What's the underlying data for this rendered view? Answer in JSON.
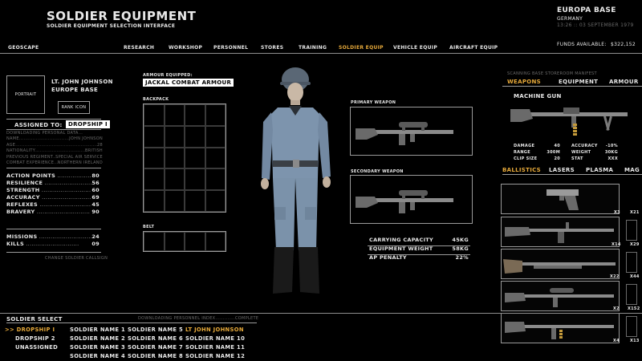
{
  "header": {
    "title": "SOLDIER EQUIPMENT",
    "subtitle": "SOLDIER EQUIPMENT SELECTION INTERFACE",
    "base_name": "EUROPA BASE",
    "base_country": "GERMANY",
    "base_time": "13:26 :: 03 SEPTEMBER 1979",
    "funds_label": "FUNDS AVAILABLE:",
    "funds_value": "$322,152"
  },
  "nav": {
    "items": [
      "GEOSCAPE",
      "RESEARCH",
      "WORKSHOP",
      "PERSONNEL",
      "STORES",
      "TRAINING",
      "SOLDIER EQUIP",
      "VEHICLE EQUIP",
      "AIRCRAFT EQUIP"
    ],
    "active": "SOLDIER EQUIP",
    "accent_color": "#e6a93a"
  },
  "soldier": {
    "portrait_label": "PORTRAIT",
    "rank_icon_label": "RANK ICON",
    "name": "LT. JOHN JOHNSON",
    "base": "EUROPE BASE",
    "assigned_label": "ASSIGNED TO:",
    "assigned_value": "DROPSHIP I",
    "personal_data": [
      {
        "key": "DOWNLOADING PERSONAL DATA...",
        "value": ""
      },
      {
        "key": "NAME",
        "value": "JOHN JOHNSON"
      },
      {
        "key": "AGE",
        "value": "28"
      },
      {
        "key": "NATIONALITY",
        "value": "BRITISH"
      },
      {
        "key": "PREVIOUS REGIMENT",
        "value": "SPECIAL AIR SERVICE"
      },
      {
        "key": "COMBAT EXPERIENCE",
        "value": "NORTHERN IRELAND"
      }
    ],
    "stats": [
      {
        "label": "ACTION POINTS",
        "value": "80"
      },
      {
        "label": "RESILIENCE",
        "value": "56"
      },
      {
        "label": "STRENGTH",
        "value": "60"
      },
      {
        "label": "ACCURACY",
        "value": "69"
      },
      {
        "label": "REFLEXES",
        "value": "45"
      },
      {
        "label": "BRAVERY",
        "value": "90"
      }
    ],
    "record": [
      {
        "label": "MISSIONS",
        "value": "24"
      },
      {
        "label": "KILLS",
        "value": "09"
      }
    ],
    "change_callsign": "CHANGE SOLDIER CALLSIGN"
  },
  "loadout": {
    "armour_label": "ARMOUR EQUIPPED:",
    "armour_value": "JACKAL COMBAT ARMOUR",
    "backpack_label": "BACKPACK",
    "belt_label": "BELT",
    "primary_label": "PRIMARY WEAPON",
    "secondary_label": "SECONDARY WEAPON",
    "capacity": [
      {
        "label": "CARRYING CAPACITY",
        "value": "45KG"
      },
      {
        "label": "EQUIPMENT WEIGHT",
        "value": "58KG"
      },
      {
        "label": "AP PENALTY",
        "value": "22%"
      }
    ]
  },
  "stores": {
    "manifest_label": "SCANNING BASE STOREROOM MANIFEST",
    "categories": [
      "WEAPONS",
      "EQUIPMENT",
      "ARMOUR"
    ],
    "active_category": "WEAPONS",
    "selected_weapon": "MACHINE GUN",
    "weapon_stats": [
      {
        "label": "DAMAGE",
        "value": "40"
      },
      {
        "label": "RANGE",
        "value": "300M"
      },
      {
        "label": "CLIP SIZE",
        "value": "20"
      },
      {
        "label": "ACCURACY",
        "value": "-10%"
      },
      {
        "label": "WEIGHT",
        "value": "30KG"
      },
      {
        "label": "STAT",
        "value": "XXX"
      }
    ],
    "subcategories": [
      "BALLISTICS",
      "LASERS",
      "PLASMA",
      "MAG"
    ],
    "active_subcategory": "BALLISTICS",
    "items": [
      {
        "icon": "pistol-icon",
        "qty": "x3",
        "ammo": "x21"
      },
      {
        "icon": "assault-rifle-icon",
        "qty": "x14",
        "ammo": "x29"
      },
      {
        "icon": "shotgun-icon",
        "qty": "x22",
        "ammo": "x44"
      },
      {
        "icon": "sniper-rifle-icon",
        "qty": "x2",
        "ammo": "x152"
      },
      {
        "icon": "machine-gun-icon",
        "qty": "x4",
        "ammo": "x13"
      }
    ]
  },
  "soldier_select": {
    "title": "SOLDIER SELECT",
    "loading": "DOWNLOADING PERSONNEL INDEX.............COMPLETE",
    "groups": [
      {
        "label": ">> DROPSHIP I",
        "active": true
      },
      {
        "label": "DROPSHIP 2",
        "active": false
      },
      {
        "label": "UNASSIGNED",
        "active": false
      }
    ],
    "names": [
      "SOLDIER NAME 1",
      "SOLDIER NAME 2",
      "SOLDIER NAME 3",
      "SOLDIER NAME 4",
      "SOLDIER NAME 5",
      "SOLDIER NAME 6",
      "SOLDIER NAME 7",
      "SOLDIER NAME 8",
      "LT JOHN JOHNSON",
      "SOLDIER NAME 10",
      "SOLDIER NAME 11",
      "SOLDIER NAME 12"
    ],
    "selected_name": "LT JOHN JOHNSON"
  }
}
